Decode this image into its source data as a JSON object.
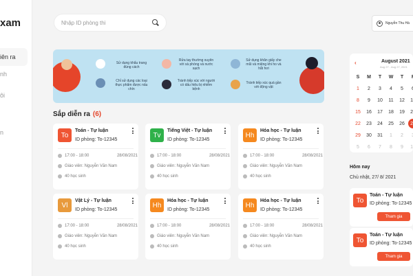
{
  "app": {
    "logo": "xam"
  },
  "sidebar": {
    "items": [
      {
        "label": "iên ra"
      },
      {
        "label": "nh"
      },
      {
        "label": "ôi"
      },
      {
        "label": "n"
      }
    ]
  },
  "search": {
    "placeholder": "Nhập ID phòng thi"
  },
  "user": {
    "name": "Nguyễn Thu Hà"
  },
  "banner": {
    "tips": [
      "Sử dụng khẩu trang đúng cách",
      "Rửa tay thường xuyên với xà phòng và nước sạch",
      "Sử dụng khăn giấy che mũi và miệng khi ho và hắt hơi",
      "Chỉ sử dụng các loại thực phẩm được nấu chín",
      "Tránh tiếp xúc với người có dấu hiệu bị nhiễm bệnh",
      "Tránh tiếp xúc quá gần với động vật"
    ]
  },
  "upcoming": {
    "title": "Sắp diễn ra",
    "count": "(6)",
    "cards": [
      {
        "badge": "To",
        "color": "#ef5533",
        "title": "Toán - Tự luận",
        "room": "ID phòng: To-12345",
        "time": "17:00 - 18:00",
        "date": "28/08/2021",
        "teacher": "Giáo viên: Nguyễn Văn Nam",
        "students": "40 học sinh"
      },
      {
        "badge": "Tv",
        "color": "#2fb14a",
        "title": "Tiếng Việt - Tự luận",
        "room": "ID phòng: To-12345",
        "time": "17:00 - 18:00",
        "date": "28/08/2021",
        "teacher": "Giáo viên: Nguyễn Văn Nam",
        "students": "40 học sinh"
      },
      {
        "badge": "Hh",
        "color": "#f5891f",
        "title": "Hóa học - Tự luận",
        "room": "ID phòng: To-12345",
        "time": "17:00 - 18:00",
        "date": "28/08/2021",
        "teacher": "Giáo viên: Nguyễn Văn Nam",
        "students": "40 học sinh"
      },
      {
        "badge": "Vl",
        "color": "#e89a3c",
        "title": "Vật Lý - Tự luận",
        "room": "ID phòng: To-12345",
        "time": "17:00 - 18:00",
        "date": "28/08/2021",
        "teacher": "Giáo viên: Nguyễn Văn Nam",
        "students": "40 học sinh"
      },
      {
        "badge": "Hh",
        "color": "#f5891f",
        "title": "Hóa học - Tự luận",
        "room": "ID phòng: To-12345",
        "time": "17:00 - 18:00",
        "date": "28/08/2021",
        "teacher": "Giáo viên: Nguyễn Văn Nam",
        "students": "40 học sinh"
      },
      {
        "badge": "Hh",
        "color": "#f5891f",
        "title": "Hóa học - Tự luận",
        "room": "ID phòng: To-12345",
        "time": "17:00 - 18:00",
        "date": "28/08/2021",
        "teacher": "Giáo viên: Nguyễn Văn Nam",
        "students": "40 học sinh"
      }
    ]
  },
  "calendar": {
    "month": "August 2021",
    "range": "Aug 27 - Aug 27, 2021",
    "weekdays": [
      "S",
      "M",
      "T",
      "W",
      "T",
      "F"
    ],
    "weeks": [
      [
        "1",
        "2",
        "3",
        "4",
        "5",
        "6"
      ],
      [
        "8",
        "9",
        "10",
        "11",
        "12",
        "13"
      ],
      [
        "15",
        "16",
        "17",
        "18",
        "19",
        "20"
      ],
      [
        "22",
        "23",
        "24",
        "25",
        "26",
        "27"
      ],
      [
        "29",
        "30",
        "31",
        "1",
        "2",
        "3"
      ],
      [
        "5",
        "6",
        "7",
        "8",
        "9",
        "10"
      ]
    ],
    "first_col": [
      "1",
      "8",
      "15",
      "22",
      "29",
      "5"
    ],
    "today": "27"
  },
  "today": {
    "title": "Hôm nay",
    "date": "Chủ nhật, 27/ 8/ 2021",
    "cards": [
      {
        "badge": "To",
        "title": "Toán - Tự luận",
        "room": "ID phòng: To-12345",
        "button": "Tham gia"
      },
      {
        "badge": "To",
        "title": "Toán - Tự luận",
        "room": "ID phòng: To-12345",
        "button": "Tham gia"
      }
    ]
  }
}
